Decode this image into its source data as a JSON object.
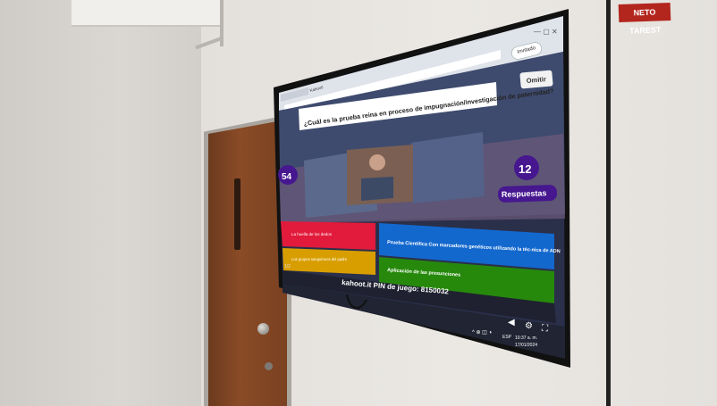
{
  "wall_sign": "NETO TAREST",
  "browser": {
    "tab_label": "Kahoot!",
    "profile_label": "Invitado"
  },
  "game": {
    "skip_label": "Omitir",
    "question": "¿Cuál es la prueba reina en proceso de impugnación/investigación de paternidad?",
    "timer": "54",
    "answers_count": "12",
    "answers_label": "Respuestas",
    "answers": [
      {
        "text": "La huella de los dedos",
        "color": "#e21b3c",
        "shape": "triangle"
      },
      {
        "text": "Prueba Científica Con marcadores genéticos utilizando la téc-nica de ADN",
        "color": "#1368ce",
        "shape": "diamond"
      },
      {
        "text": "Los grupos sanguíneos del padre",
        "color": "#d89e00",
        "shape": "circle"
      },
      {
        "text": "Aplicación de las presunciones",
        "color": "#26890c",
        "shape": "square"
      }
    ],
    "footer_left": "1/2",
    "footer_pin": "kahoot.it PIN de juego: 8150032"
  },
  "taskbar": {
    "lang": "ESP",
    "time": "10:37 a. m.",
    "date": "17/01/2024"
  }
}
